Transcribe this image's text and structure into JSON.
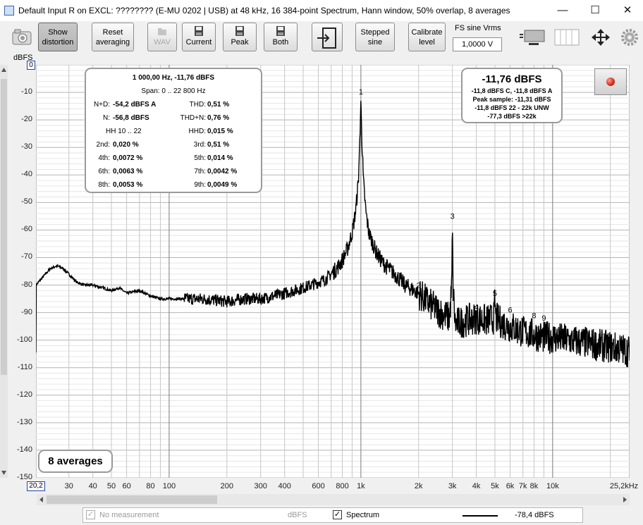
{
  "window": {
    "title": "Default Input R on EXCL: ???????? (E-MU 0202 | USB) at 48 kHz, 16 384-point Spectrum, Hann window, 50% overlap, 8 averages",
    "minimize_glyph": "—",
    "maximize_glyph": "☐",
    "close_glyph": "✕"
  },
  "toolbar": {
    "show_distortion": "Show distortion",
    "reset_averaging": "Reset averaging",
    "wav": "WAV",
    "current": "Current",
    "peak": "Peak",
    "both": "Both",
    "stepped_sine": "Stepped sine",
    "calibrate_level": "Calibrate level",
    "fs_label": "FS sine Vrms",
    "fs_value": "1,0000 V"
  },
  "info_panel": {
    "freq_level": "1 000,00 Hz, -11,76 dBFS",
    "span": "Span: 0 .. 22 800 Hz",
    "rows": [
      {
        "l1": "N+D:",
        "v1": "-54,2 dBFS A",
        "l2": "THD:",
        "v2": "0,51 %"
      },
      {
        "l1": "N:",
        "v1": "-56,8 dBFS",
        "l2": "THD+N:",
        "v2": "0,76 %"
      },
      {
        "l1": "HH 10 .. 22",
        "v1": "",
        "l2": "HHD:",
        "v2": "0,015 %"
      },
      {
        "l1": "2nd:",
        "v1": "0,020 %",
        "l2": "3rd:",
        "v2": "0,51 %"
      },
      {
        "l1": "4th:",
        "v1": "0,0072 %",
        "l2": "5th:",
        "v2": "0,014 %"
      },
      {
        "l1": "6th:",
        "v1": "0,0063 %",
        "l2": "7th:",
        "v2": "0,0042 %"
      },
      {
        "l1": "8th:",
        "v1": "0,0053 %",
        "l2": "9th:",
        "v2": "0,0049 %"
      }
    ]
  },
  "level_panel": {
    "main": "-11,76 dBFS",
    "line1": "-11,8 dBFS C, -11,8 dBFS A",
    "line2": "Peak sample: -11,31 dBFS",
    "line3": "-11,8 dBFS 22 - 22k UNW",
    "line4": "-77,3 dBFS >22k"
  },
  "averages_label": "8 averages",
  "legend": {
    "no_measurement": "No measurement",
    "dbfs": "dBFS",
    "spectrum": "Spectrum",
    "spectrum_level": "-78,4 dBFS"
  },
  "chart_data": {
    "type": "line",
    "ylabel": "dBFS",
    "ylim": [
      -150,
      0
    ],
    "xlim": [
      20.2,
      25200
    ],
    "xscale": "log",
    "y_top_box": "0",
    "x_left_box": "20,2",
    "yticks": [
      "-10",
      "-20",
      "-30",
      "-40",
      "-50",
      "-60",
      "-70",
      "-80",
      "-90",
      "-100",
      "-110",
      "-120",
      "-130",
      "-140",
      "-150"
    ],
    "xticks": [
      {
        "v": 30,
        "t": "30"
      },
      {
        "v": 40,
        "t": "40"
      },
      {
        "v": 50,
        "t": "50"
      },
      {
        "v": 60,
        "t": "60"
      },
      {
        "v": 80,
        "t": "80"
      },
      {
        "v": 100,
        "t": "100"
      },
      {
        "v": 200,
        "t": "200"
      },
      {
        "v": 300,
        "t": "300"
      },
      {
        "v": 400,
        "t": "400"
      },
      {
        "v": 600,
        "t": "600"
      },
      {
        "v": 800,
        "t": "800"
      },
      {
        "v": 1000,
        "t": "1k"
      },
      {
        "v": 2000,
        "t": "2k"
      },
      {
        "v": 3000,
        "t": "3k"
      },
      {
        "v": 4000,
        "t": "4k"
      },
      {
        "v": 5000,
        "t": "5k"
      },
      {
        "v": 6000,
        "t": "6k"
      },
      {
        "v": 7000,
        "t": "7k"
      },
      {
        "v": 8000,
        "t": "8k"
      },
      {
        "v": 10000,
        "t": "10k"
      },
      {
        "v": 25200,
        "t": "25,2kHz"
      }
    ],
    "harmonics": [
      {
        "label": "1",
        "x": 1000,
        "y": -11.8
      },
      {
        "label": "2",
        "x": 2000,
        "y": -82
      },
      {
        "label": "3",
        "x": 3000,
        "y": -57
      },
      {
        "label": "4",
        "x": 4000,
        "y": -90
      },
      {
        "label": "5",
        "x": 5000,
        "y": -85
      },
      {
        "label": "6",
        "x": 6000,
        "y": -91
      },
      {
        "label": "7",
        "x": 7000,
        "y": -95
      },
      {
        "label": "8",
        "x": 8000,
        "y": -93
      },
      {
        "label": "9",
        "x": 9000,
        "y": -94
      }
    ],
    "series": [
      {
        "points": [
          [
            20.2,
            -80
          ],
          [
            22,
            -77
          ],
          [
            24,
            -74
          ],
          [
            26,
            -73
          ],
          [
            28,
            -74
          ],
          [
            30,
            -76
          ],
          [
            33,
            -79
          ],
          [
            36,
            -80
          ],
          [
            40,
            -80
          ],
          [
            45,
            -81
          ],
          [
            50,
            -82
          ],
          [
            55,
            -81
          ],
          [
            60,
            -83
          ],
          [
            70,
            -82
          ],
          [
            80,
            -84
          ],
          [
            90,
            -85
          ],
          [
            100,
            -85
          ],
          [
            120,
            -85
          ],
          [
            150,
            -85
          ],
          [
            200,
            -86
          ],
          [
            250,
            -85
          ],
          [
            300,
            -85
          ],
          [
            350,
            -84
          ],
          [
            400,
            -83
          ],
          [
            450,
            -82
          ],
          [
            500,
            -81
          ],
          [
            550,
            -80
          ],
          [
            600,
            -79
          ],
          [
            650,
            -78
          ],
          [
            700,
            -76
          ],
          [
            750,
            -74
          ],
          [
            800,
            -71
          ],
          [
            850,
            -67
          ],
          [
            900,
            -61
          ],
          [
            940,
            -53
          ],
          [
            970,
            -42
          ],
          [
            990,
            -25
          ],
          [
            1000,
            -11.8
          ],
          [
            1010,
            -25
          ],
          [
            1030,
            -42
          ],
          [
            1060,
            -53
          ],
          [
            1100,
            -61
          ],
          [
            1200,
            -68
          ],
          [
            1300,
            -72
          ],
          [
            1500,
            -76
          ],
          [
            1700,
            -80
          ],
          [
            2000,
            -83
          ],
          [
            2300,
            -87
          ],
          [
            2600,
            -90
          ],
          [
            2900,
            -92
          ],
          [
            2980,
            -80
          ],
          [
            3000,
            -57
          ],
          [
            3020,
            -80
          ],
          [
            3100,
            -94
          ],
          [
            3500,
            -93
          ],
          [
            4000,
            -92
          ],
          [
            4500,
            -93
          ],
          [
            4950,
            -92
          ],
          [
            5000,
            -85
          ],
          [
            5050,
            -92
          ],
          [
            5500,
            -94
          ],
          [
            6000,
            -95
          ],
          [
            7000,
            -97
          ],
          [
            8000,
            -98
          ],
          [
            9000,
            -99
          ],
          [
            10000,
            -99
          ],
          [
            12000,
            -100
          ],
          [
            15000,
            -101
          ],
          [
            18000,
            -102
          ],
          [
            22000,
            -103
          ],
          [
            25200,
            -104
          ]
        ]
      }
    ]
  }
}
